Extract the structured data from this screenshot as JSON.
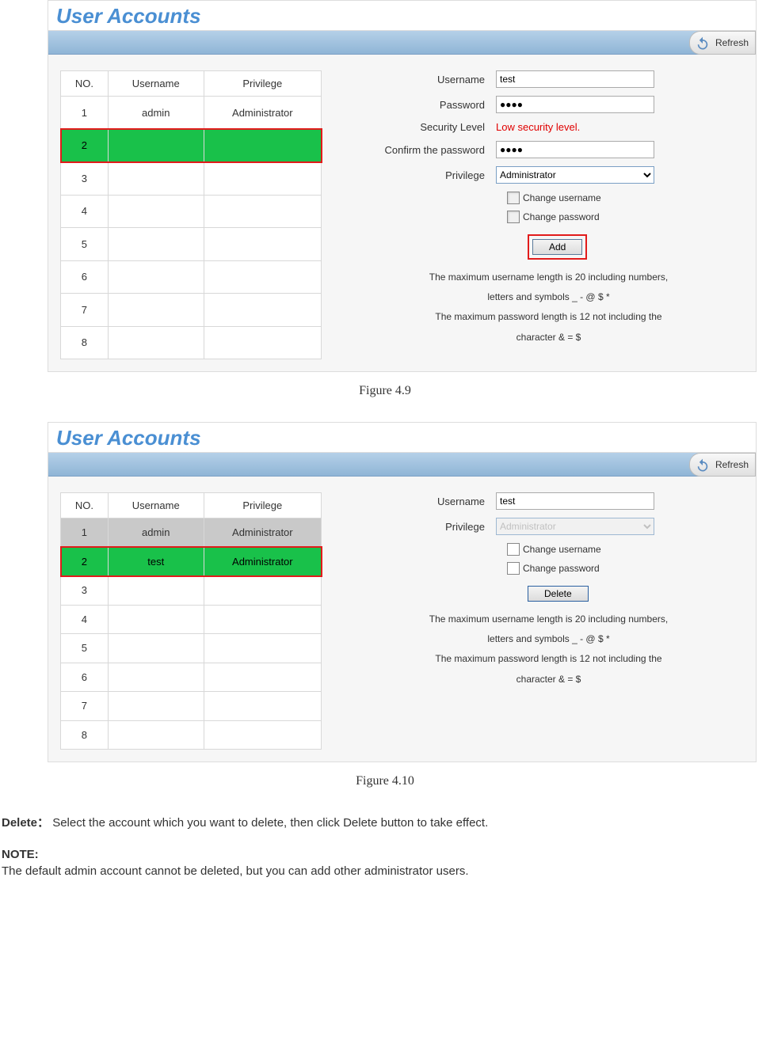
{
  "figure1": {
    "title": "User Accounts",
    "refresh": "Refresh",
    "table": {
      "headers": {
        "no": "NO.",
        "username": "Username",
        "privilege": "Privilege"
      },
      "rows": [
        {
          "no": "1",
          "username": "admin",
          "privilege": "Administrator",
          "selected": false
        },
        {
          "no": "2",
          "username": "",
          "privilege": "",
          "selected": true
        },
        {
          "no": "3",
          "username": "",
          "privilege": ""
        },
        {
          "no": "4",
          "username": "",
          "privilege": ""
        },
        {
          "no": "5",
          "username": "",
          "privilege": ""
        },
        {
          "no": "6",
          "username": "",
          "privilege": ""
        },
        {
          "no": "7",
          "username": "",
          "privilege": ""
        },
        {
          "no": "8",
          "username": "",
          "privilege": ""
        }
      ]
    },
    "form": {
      "labels": {
        "username": "Username",
        "password": "Password",
        "seclevel": "Security Level",
        "confirm": "Confirm the password",
        "privilege": "Privilege",
        "chg_user": "Change username",
        "chg_pass": "Change password"
      },
      "values": {
        "username": "test",
        "password": "●●●●",
        "sec_warning": "Low security level.",
        "confirm": "●●●●",
        "privilege": "Administrator"
      },
      "button": "Add",
      "hint1": "The maximum username length is 20 including numbers,",
      "hint2": "letters and symbols _ - @ $ *",
      "hint3": "The maximum password length is 12 not including the",
      "hint4": "character & = $"
    },
    "caption": "Figure 4.9"
  },
  "figure2": {
    "title": "User Accounts",
    "refresh": "Refresh",
    "table": {
      "headers": {
        "no": "NO.",
        "username": "Username",
        "privilege": "Privilege"
      },
      "rows": [
        {
          "no": "1",
          "username": "admin",
          "privilege": "Administrator",
          "gray": true
        },
        {
          "no": "2",
          "username": "test",
          "privilege": "Administrator",
          "selected": true
        },
        {
          "no": "3",
          "username": "",
          "privilege": ""
        },
        {
          "no": "4",
          "username": "",
          "privilege": ""
        },
        {
          "no": "5",
          "username": "",
          "privilege": ""
        },
        {
          "no": "6",
          "username": "",
          "privilege": ""
        },
        {
          "no": "7",
          "username": "",
          "privilege": ""
        },
        {
          "no": "8",
          "username": "",
          "privilege": ""
        }
      ]
    },
    "form": {
      "labels": {
        "username": "Username",
        "privilege": "Privilege",
        "chg_user": "Change username",
        "chg_pass": "Change password"
      },
      "values": {
        "username": "test",
        "privilege": "Administrator"
      },
      "button": "Delete",
      "hint1": "The maximum username length is 20 including numbers,",
      "hint2": "letters and symbols _ - @ $ *",
      "hint3": "The maximum password length is 12 not including the",
      "hint4": "character & = $"
    },
    "caption": "Figure 4.10"
  },
  "doc": {
    "delete_label": "Delete：",
    "delete_text": "Select the account which you want to delete, then click Delete button to take effect.",
    "note_title": "NOTE:",
    "note_body": "The default admin account cannot be deleted, but you can add other administrator users."
  }
}
